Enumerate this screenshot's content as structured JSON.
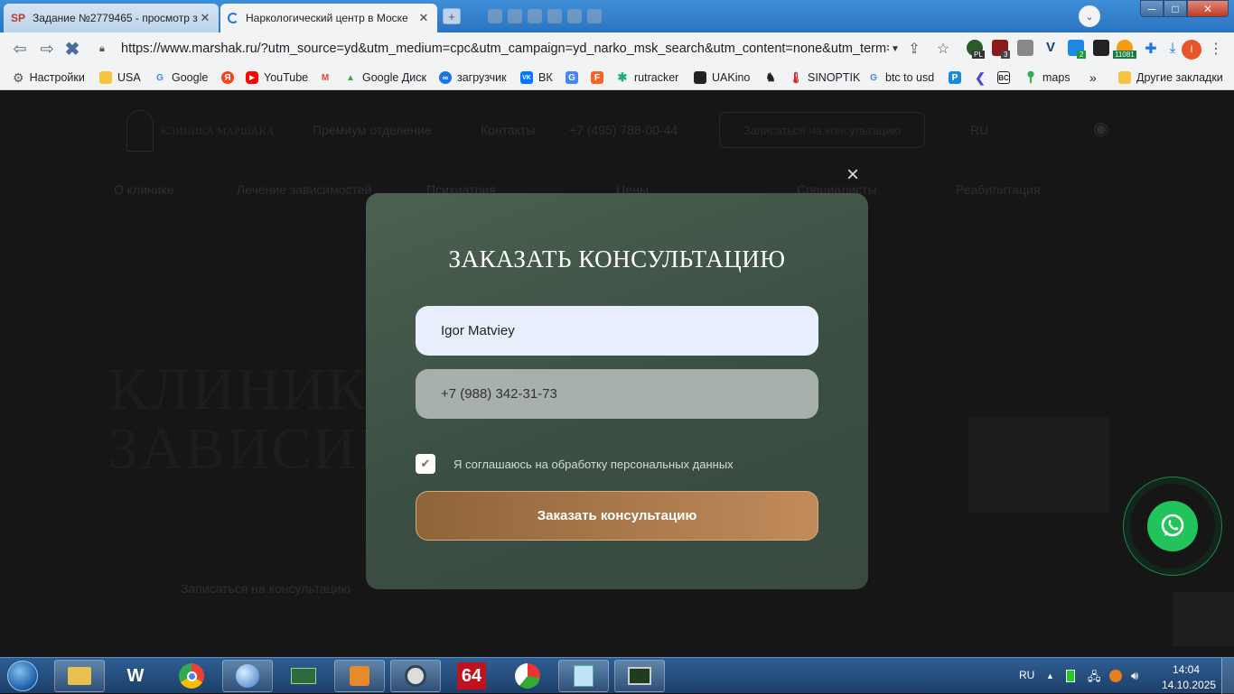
{
  "browser": {
    "tabs": [
      {
        "favicon": "SP",
        "title": "Задание №2779465 - просмотр з",
        "active": false
      },
      {
        "favicon": "loading-spinner",
        "title": "Наркологический центр в Моске",
        "active": true
      }
    ],
    "new_tab_glyph": "+",
    "url": "https://www.marshak.ru/?utm_source=yd&utm_medium=cpc&utm_campaign=yd_narko_msk_search&utm_content=none&utm_term=н...",
    "extensions": {
      "pl_badge": "PL",
      "counter_badge": "3",
      "download_badge": "2",
      "coin_badge": "11081",
      "profile_letter": "I"
    },
    "bookmarks": [
      {
        "label": "Настройки",
        "icon": "gear-icon"
      },
      {
        "label": "USA",
        "icon": "folder-icon"
      },
      {
        "label": "Google",
        "icon": "google-icon"
      },
      {
        "label": "",
        "icon": "yandex-icon"
      },
      {
        "label": "YouTube",
        "icon": "youtube-icon"
      },
      {
        "label": "",
        "icon": "gmail-icon"
      },
      {
        "label": "Google Диск",
        "icon": "drive-icon"
      },
      {
        "label": "загрузчик",
        "icon": "loop-icon"
      },
      {
        "label": "ВК",
        "icon": "vk-icon"
      },
      {
        "label": "",
        "icon": "translate-icon"
      },
      {
        "label": "",
        "icon": "f-icon"
      },
      {
        "label": "rutracker",
        "icon": "star-icon"
      },
      {
        "label": "UAKino",
        "icon": "film-icon"
      },
      {
        "label": "",
        "icon": "chess-icon"
      },
      {
        "label": "SINOPTIK",
        "icon": "thermometer-icon"
      },
      {
        "label": "btc to usd",
        "icon": "google-icon"
      },
      {
        "label": "",
        "icon": "p-icon"
      },
      {
        "label": "",
        "icon": "arrow-icon"
      },
      {
        "label": "",
        "icon": "bc-icon"
      },
      {
        "label": "maps",
        "icon": "maps-icon"
      }
    ],
    "bookmarks_overflow": "»",
    "other_bookmarks": "Другие закладки"
  },
  "page": {
    "logo_line1": "КЛИНИКА МАРШАКА",
    "nav": [
      "Премиум отделение",
      "Контакты"
    ],
    "phone": "+7 (495) 788-00-44",
    "cta": "Записаться на консультацию",
    "lang": "RU",
    "menu": [
      "О клинике",
      "Лечение зависимостей",
      "Психиатрия",
      "Цены",
      "Специалисты",
      "Реабилитация"
    ],
    "hero_line1": "КЛИНИКА",
    "hero_line2": "ЗАВИСИМ",
    "hero_link": "Записаться на консультацию"
  },
  "modal": {
    "title": "ЗАКАЗАТЬ КОНСУЛЬТАЦИЮ",
    "name_value": "Igor Matviey",
    "phone_value": "+7 (988) 342-31-73",
    "consent_label": "Я соглашаюсь на обработку персональных данных",
    "consent_checked": true,
    "submit_label": "Заказать консультацию",
    "close_glyph": "×"
  },
  "taskbar": {
    "apps": [
      "explorer-icon",
      "shield-icon",
      "chrome-icon",
      "globe-icon",
      "board-icon",
      "media-icon",
      "clock-icon",
      "aida64-icon",
      "chart-icon",
      "notepad-icon",
      "monitor-icon"
    ],
    "aida_label": "64",
    "lang": "RU",
    "time": "14:04",
    "date": "14.10.2025"
  },
  "colors": {
    "accent_gold": "#c28b5b",
    "modal_green": "#4c6151",
    "whatsapp": "#21c35b"
  }
}
